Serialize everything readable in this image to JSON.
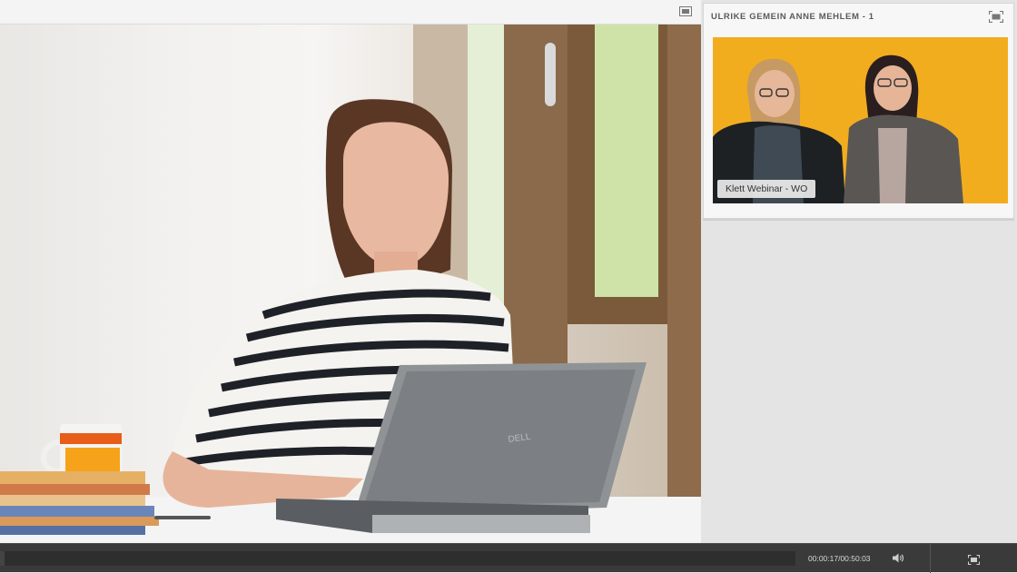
{
  "main_pod": {
    "fullscreen_icon": "fullscreen-icon",
    "image_description_icon": "photo"
  },
  "camera_pod": {
    "title": "ULRIKE GEMEIN ANNE MEHLEM - 1",
    "fullscreen_icon": "fullscreen-icon",
    "video_name_tag": "Klett Webinar - WO",
    "background_color": "#f1ae1c"
  },
  "player": {
    "time": "00:00:17/00:50:03",
    "progress": 0.0057,
    "volume_icon": "speaker-icon",
    "fullscreen_icon": "fullscreen-icon"
  }
}
